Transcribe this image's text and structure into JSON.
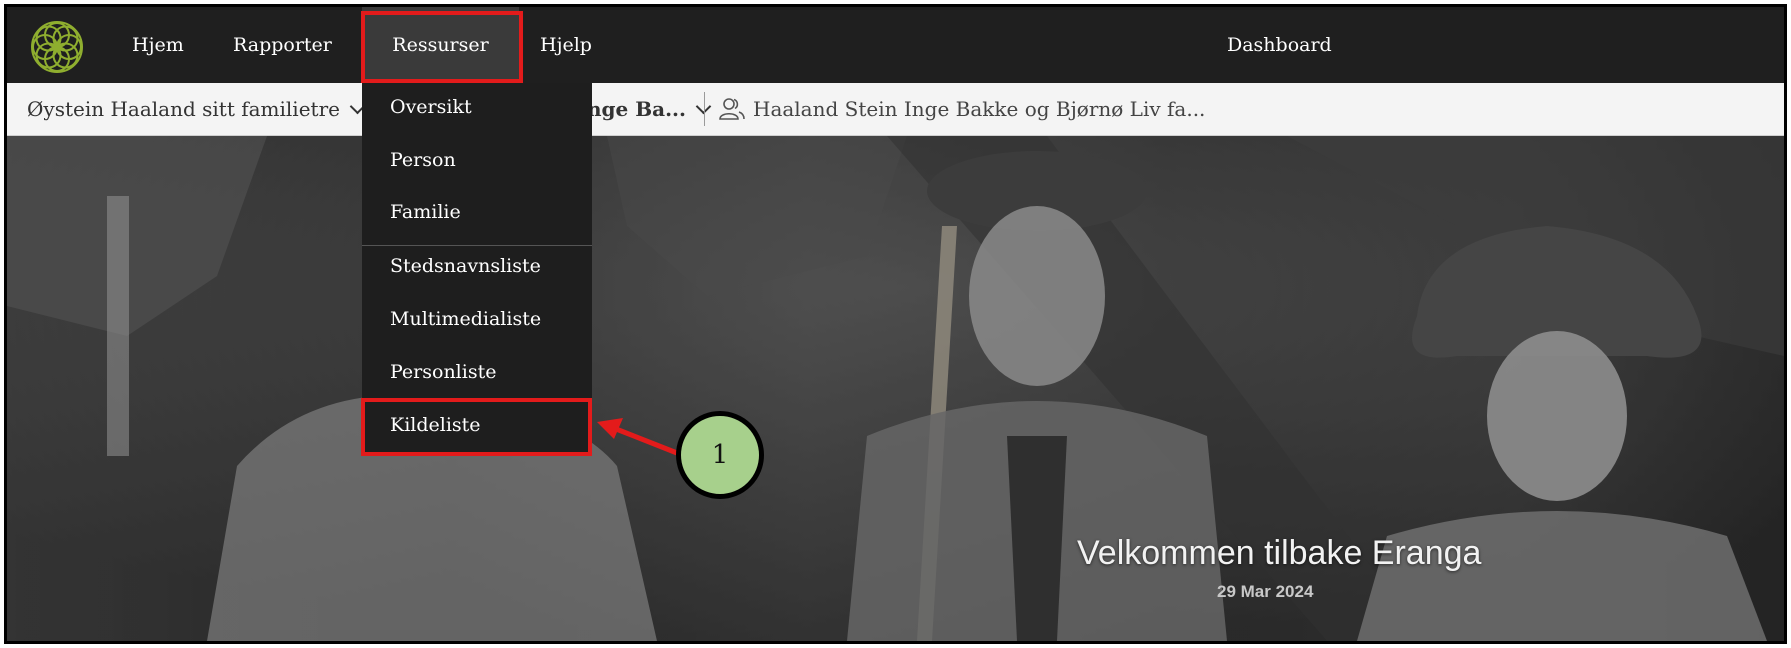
{
  "nav": {
    "items": [
      {
        "label": "Hjem"
      },
      {
        "label": "Rapporter"
      },
      {
        "label": "Ressurser"
      },
      {
        "label": "Hjelp"
      }
    ],
    "dashboard": "Dashboard"
  },
  "subbar": {
    "tree": "Øystein Haaland sitt familietre",
    "person_partial": "nge Ba...",
    "family": "Haaland Stein Inge Bakke og Bjørnø Liv fa..."
  },
  "dropdown": {
    "items": [
      {
        "label": "Oversikt"
      },
      {
        "label": "Person"
      },
      {
        "label": "Familie"
      },
      {
        "label": "Stedsnavnsliste"
      },
      {
        "label": "Multimedialiste"
      },
      {
        "label": "Personliste"
      },
      {
        "label": "Kildeliste"
      }
    ]
  },
  "hero": {
    "title": "Velkommen tilbake Eranga",
    "date": "29 Mar 2024"
  },
  "annotation": {
    "step": "1"
  },
  "colors": {
    "highlight": "#e31b1b",
    "callout": "#a7d08c",
    "logo": "#8fae2f"
  }
}
